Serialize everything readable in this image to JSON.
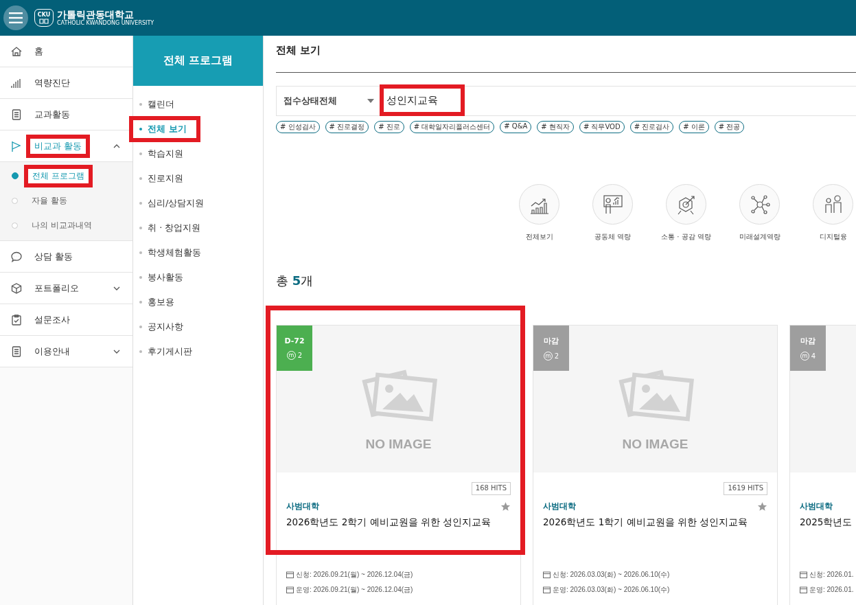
{
  "header": {
    "logo_korean": "가톨릭관동대학교",
    "logo_english": "CATHOLIC KWANDONG UNIVERSITY",
    "logo_mark_top": "CKU"
  },
  "sidebar": {
    "items": [
      {
        "label": "홈"
      },
      {
        "label": "역량진단"
      },
      {
        "label": "교과활동"
      },
      {
        "label": "비교과 활동",
        "expanded": true,
        "active": true,
        "highlighted": true,
        "children": [
          {
            "label": "전체 프로그램",
            "selected": true,
            "highlighted": true
          },
          {
            "label": "자율 활동",
            "selected": false,
            "highlighted": false
          },
          {
            "label": "나의 비교과내역",
            "selected": false,
            "highlighted": false
          }
        ]
      },
      {
        "label": "상담 활동"
      },
      {
        "label": "포트폴리오",
        "expanded": false,
        "active": false,
        "highlighted": false
      },
      {
        "label": "설문조사"
      },
      {
        "label": "이용안내",
        "expanded": false,
        "active": false,
        "highlighted": false
      }
    ]
  },
  "submenu": {
    "title": "전체 프로그램",
    "items": [
      {
        "label": "캘린더",
        "selected": false,
        "highlighted": false
      },
      {
        "label": "전체 보기",
        "selected": true,
        "highlighted": true
      },
      {
        "label": "학습지원",
        "selected": false,
        "highlighted": false
      },
      {
        "label": "진로지원",
        "selected": false,
        "highlighted": false
      },
      {
        "label": "심리/상담지원",
        "selected": false,
        "highlighted": false
      },
      {
        "label": "취 · 창업지원",
        "selected": false,
        "highlighted": false
      },
      {
        "label": "학생체험활동",
        "selected": false,
        "highlighted": false
      },
      {
        "label": "봉사활동",
        "selected": false,
        "highlighted": false
      },
      {
        "label": "홍보용",
        "selected": false,
        "highlighted": false
      },
      {
        "label": "공지사항",
        "selected": false,
        "highlighted": false
      },
      {
        "label": "후기게시판",
        "selected": false,
        "highlighted": false
      }
    ]
  },
  "main": {
    "title": "전체 보기",
    "filter": {
      "status_select": "접수상태전체",
      "search_value": "성인지교육",
      "search_highlighted": true
    },
    "tags": [
      "# 인성검사",
      "# 진로결정",
      "# 진로",
      "# 대학일자리플러스센터",
      "# Q&A",
      "# 현직자",
      "# 직무VOD",
      "# 진로검사",
      "# 이론",
      "# 전공"
    ],
    "categories": [
      {
        "label": "전체보기"
      },
      {
        "label": "공동체 역량"
      },
      {
        "label": "소통 · 공감 역량"
      },
      {
        "label": "미래설계역량"
      },
      {
        "label": "디지털융"
      }
    ],
    "total": {
      "label": "총",
      "count": "5",
      "unit": "개"
    },
    "cards": [
      {
        "badge": "D-72",
        "color": "#4caf50",
        "member_symbol": "m",
        "members": "2",
        "image_placeholder": "NO IMAGE",
        "hits": "168 HITS",
        "college": "사범대학",
        "title": "2026학년도 2학기 예비교원을 위한 성인지교육",
        "apply": "신청: 2026.09.21(월) ~ 2026.12.04(금)",
        "run": "운영: 2026.09.21(월) ~ 2026.12.04(금)",
        "highlighted": true
      },
      {
        "badge": "마감",
        "color": "#9e9e9e",
        "member_symbol": "m",
        "members": "2",
        "image_placeholder": "NO IMAGE",
        "hits": "1619 HITS",
        "college": "사범대학",
        "title": "2026학년도 1학기 예비교원을 위한 성인지교육",
        "apply": "신청: 2026.03.03(화) ~ 2026.06.10(수)",
        "run": "운영: 2026.03.03(화) ~ 2026.06.10(수)",
        "highlighted": false
      },
      {
        "badge": "마감",
        "color": "#9e9e9e",
        "member_symbol": "m",
        "members": "4",
        "college": "사범대학",
        "title": "2025학년도",
        "apply": "신청: 2026.01.",
        "run": "운영: 2026.01.",
        "highlighted": false
      }
    ]
  }
}
